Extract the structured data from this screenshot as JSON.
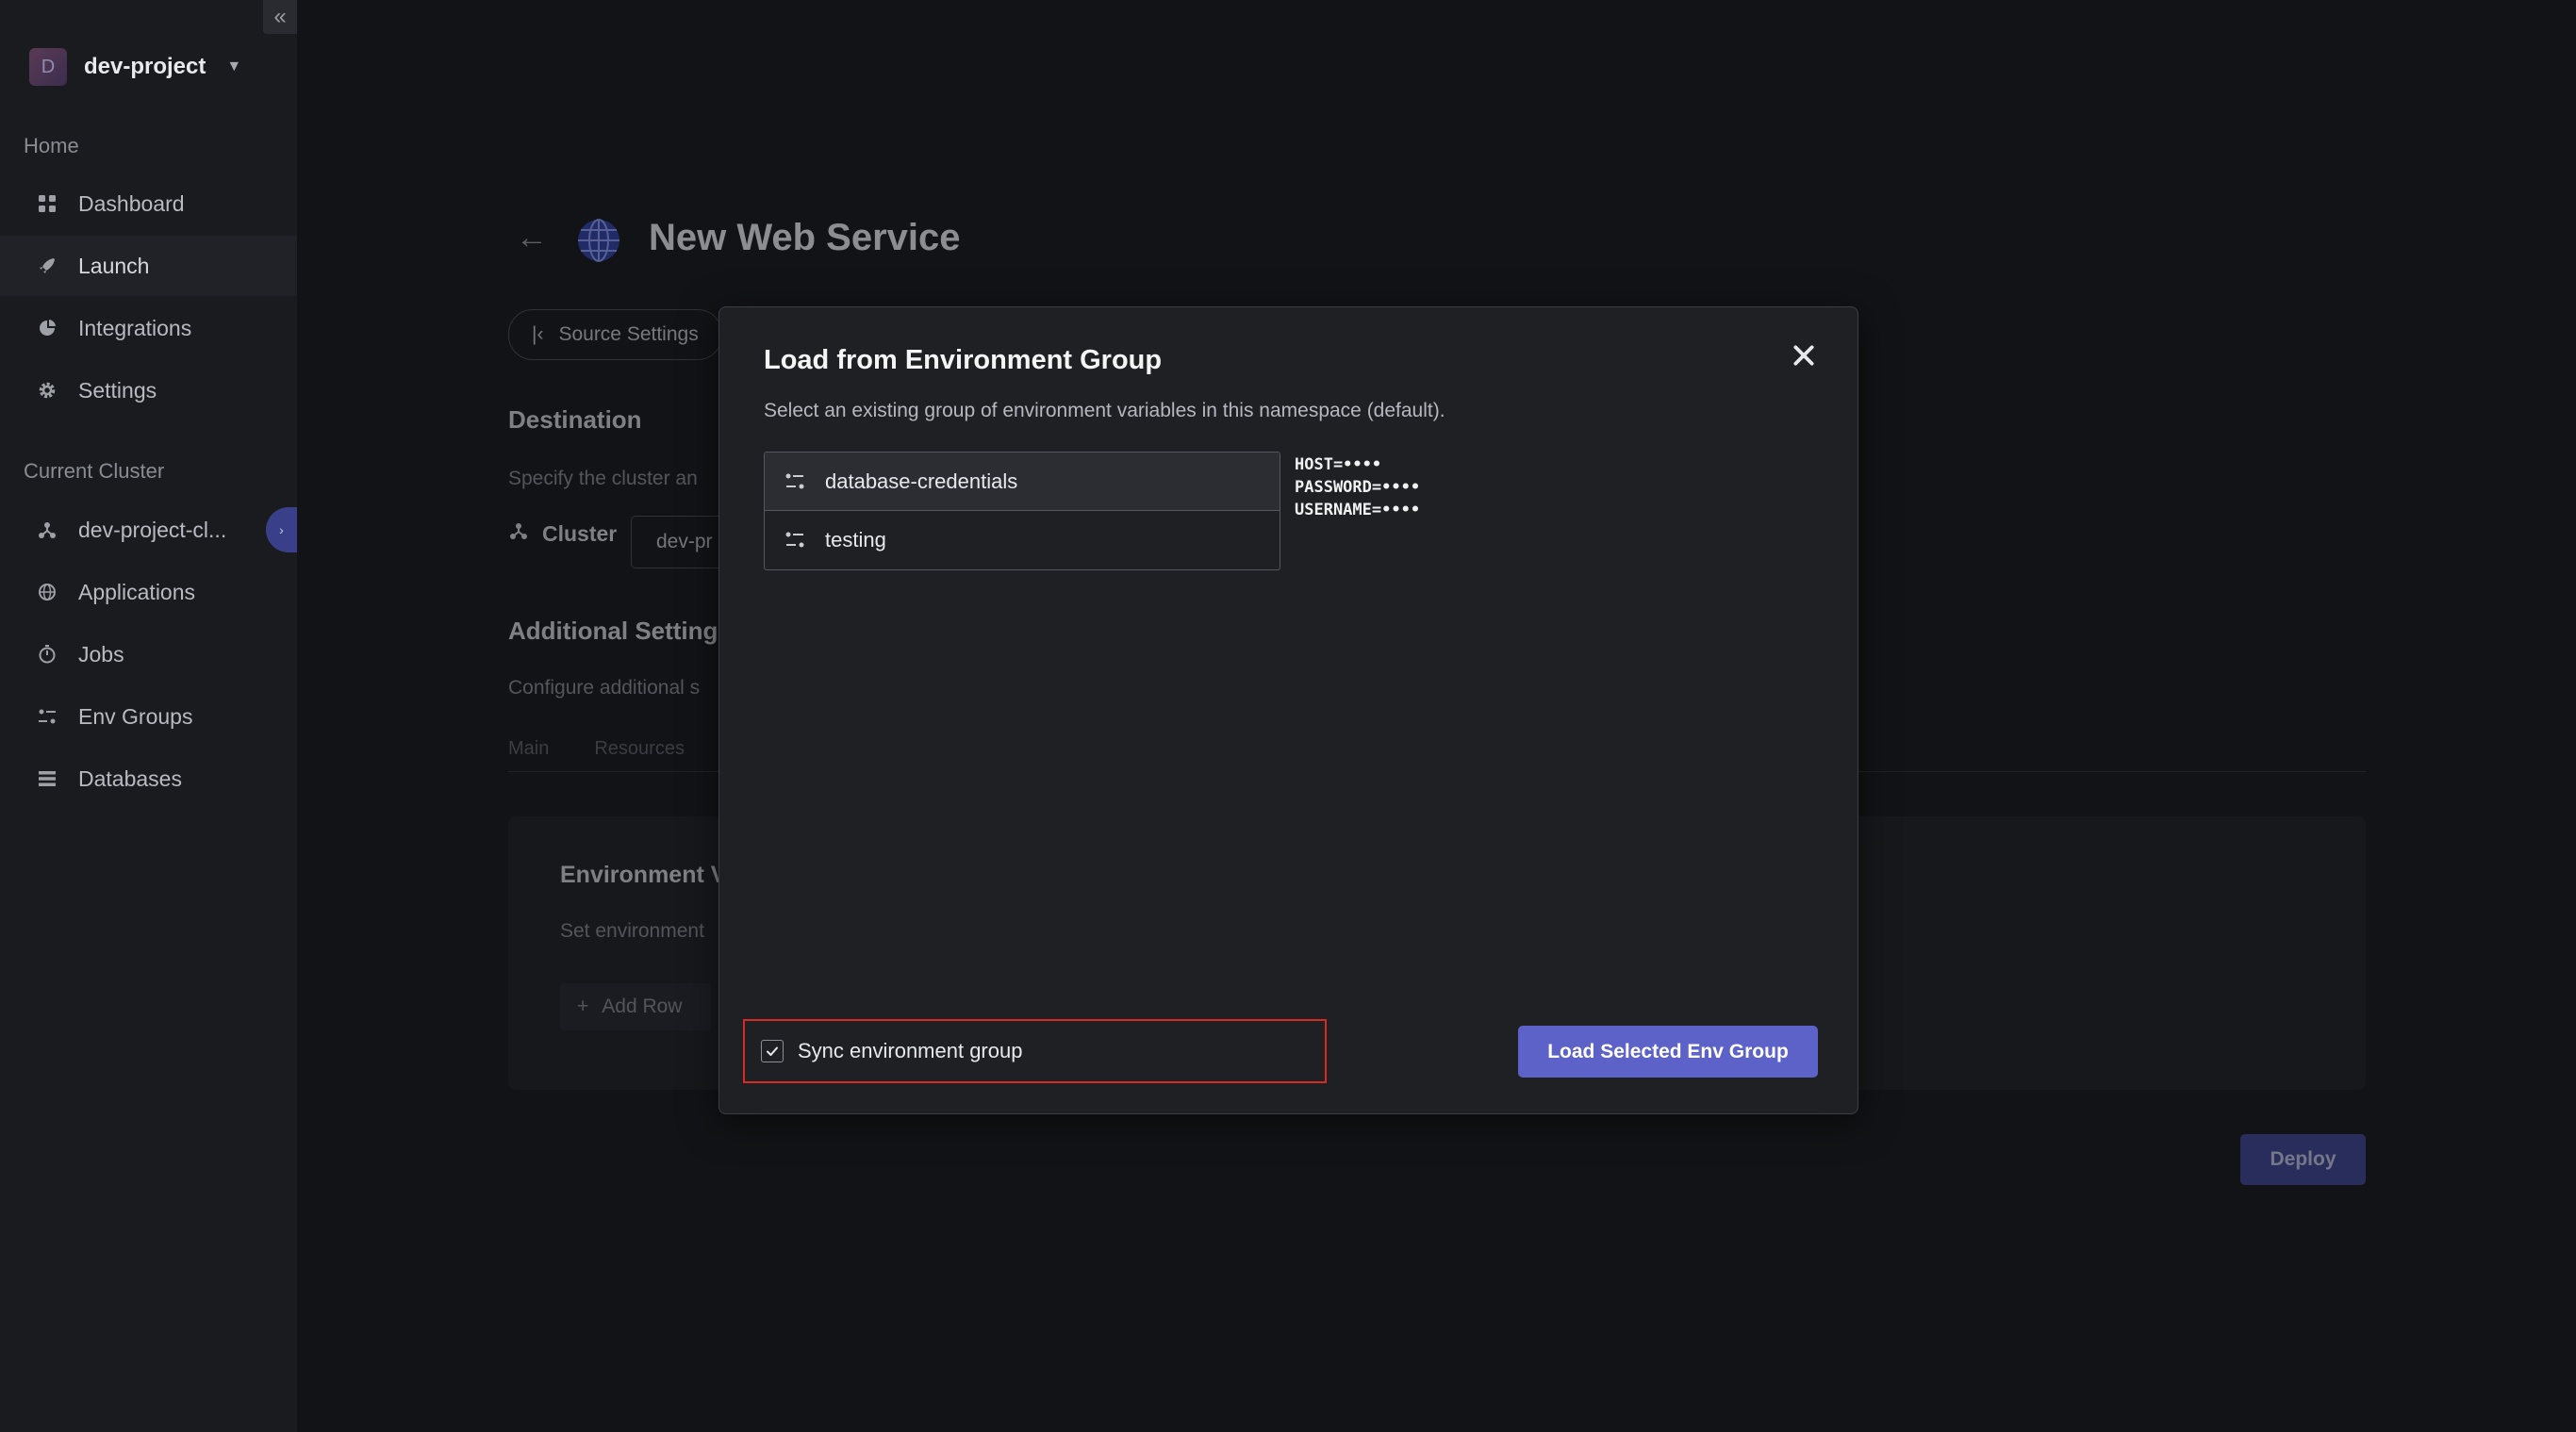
{
  "sidebar": {
    "project": {
      "avatar_letter": "D",
      "name": "dev-project"
    },
    "home_label": "Home",
    "home_items": [
      {
        "label": "Dashboard",
        "icon": "grid-icon"
      },
      {
        "label": "Launch",
        "icon": "rocket-icon",
        "active": true
      },
      {
        "label": "Integrations",
        "icon": "pie-chart-icon"
      },
      {
        "label": "Settings",
        "icon": "gear-icon"
      }
    ],
    "cluster_label": "Current Cluster",
    "cluster_items": [
      {
        "label": "dev-project-cl...",
        "icon": "cluster-icon"
      },
      {
        "label": "Applications",
        "icon": "globe-icon"
      },
      {
        "label": "Jobs",
        "icon": "timer-icon"
      },
      {
        "label": "Env Groups",
        "icon": "sliders-icon"
      },
      {
        "label": "Databases",
        "icon": "database-icon"
      }
    ]
  },
  "main": {
    "title": "New Web Service",
    "breadcrumb": "Source Settings",
    "destination_heading": "Destination",
    "destination_sub": "Specify the cluster an",
    "cluster_label": "Cluster",
    "cluster_value": "dev-pr",
    "additional_heading": "Additional Setting",
    "additional_sub": "Configure additional s",
    "tabs": [
      "Main",
      "Resources"
    ],
    "env_heading": "Environment V",
    "env_sub": "Set environment",
    "add_row": "Add Row",
    "deploy": "Deploy"
  },
  "modal": {
    "title": "Load from Environment Group",
    "description": "Select an existing group of environment variables in this namespace (default).",
    "groups": [
      {
        "name": "database-credentials",
        "selected": true
      },
      {
        "name": "testing",
        "selected": false
      }
    ],
    "variables": [
      "HOST=••••",
      "PASSWORD=••••",
      "USERNAME=••••"
    ],
    "sync_label": "Sync environment group",
    "sync_checked": true,
    "load_button": "Load Selected Env Group"
  },
  "colors": {
    "accent": "#5c62c8",
    "highlight_border": "#d62b24",
    "background": "#121316",
    "sidebar": "#1a1b1f"
  }
}
